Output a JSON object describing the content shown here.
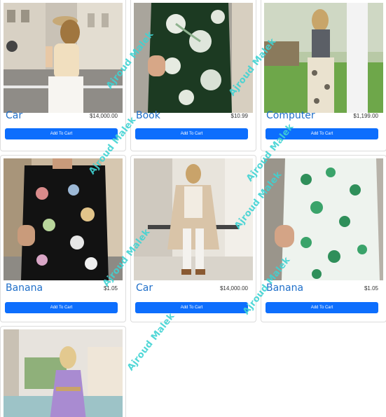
{
  "products": [
    {
      "title": "Car",
      "price": "$14,000.00",
      "button": "Add To Cart",
      "image": "woman-beige-top-street-photo"
    },
    {
      "title": "Book",
      "price": "$10.99",
      "button": "Add To Cart",
      "image": "green-floral-shirt-photo"
    },
    {
      "title": "Computer",
      "price": "$1,199.00",
      "button": "Add To Cart",
      "image": "woman-patterned-pants-photo"
    },
    {
      "title": "Banana",
      "price": "$1.05",
      "button": "Add To Cart",
      "image": "black-floral-shirt-photo"
    },
    {
      "title": "Car",
      "price": "$14,000.00",
      "button": "Add To Cart",
      "image": "woman-beige-coat-photo"
    },
    {
      "title": "Banana",
      "price": "$1.05",
      "button": "Add To Cart",
      "image": "white-green-floral-shirt-photo"
    },
    {
      "image": "woman-lavender-dress-photo"
    }
  ],
  "watermark": {
    "text": "Ajroud Malek",
    "color": "#3fd3d3"
  },
  "colors": {
    "accent": "#0d6efd",
    "title": "#1f6fc9"
  }
}
